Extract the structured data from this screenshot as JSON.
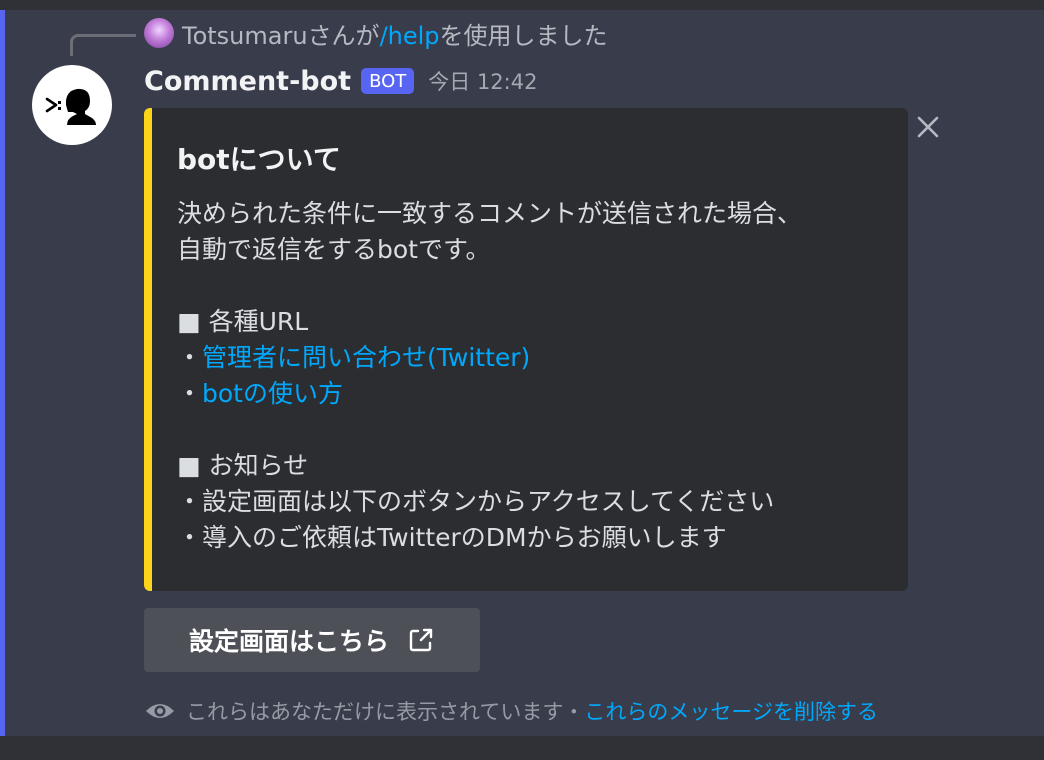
{
  "reply": {
    "username": "Totsumaru",
    "text_before": "さんが",
    "command": "/help",
    "text_after": "を使用しました"
  },
  "message": {
    "username": "Comment-bot",
    "bot_tag": "BOT",
    "timestamp": "今日 12:42"
  },
  "embed": {
    "accent_color": "#fcd418",
    "title": "botについて",
    "description_lines": [
      "決められた条件に一致するコメントが送信された場合、",
      "自動で返信をするbotです。"
    ],
    "urls_header": "■ 各種URL",
    "bullet": "・",
    "links": [
      "管理者に問い合わせ(Twitter)",
      "botの使い方"
    ],
    "notice_header": "■ お知らせ",
    "notices": [
      "・設定画面は以下のボタンからアクセスしてください",
      "・導入のご依頼はTwitterのDMからお願いします"
    ]
  },
  "button": {
    "label": "設定画面はこちら"
  },
  "ephemeral": {
    "text": "これらはあなただけに表示されています・",
    "dismiss": "これらのメッセージを削除する"
  },
  "icons": {
    "avatar": "speaking-head-icon",
    "close": "close-icon",
    "external": "external-link-icon",
    "eye": "eye-icon"
  }
}
